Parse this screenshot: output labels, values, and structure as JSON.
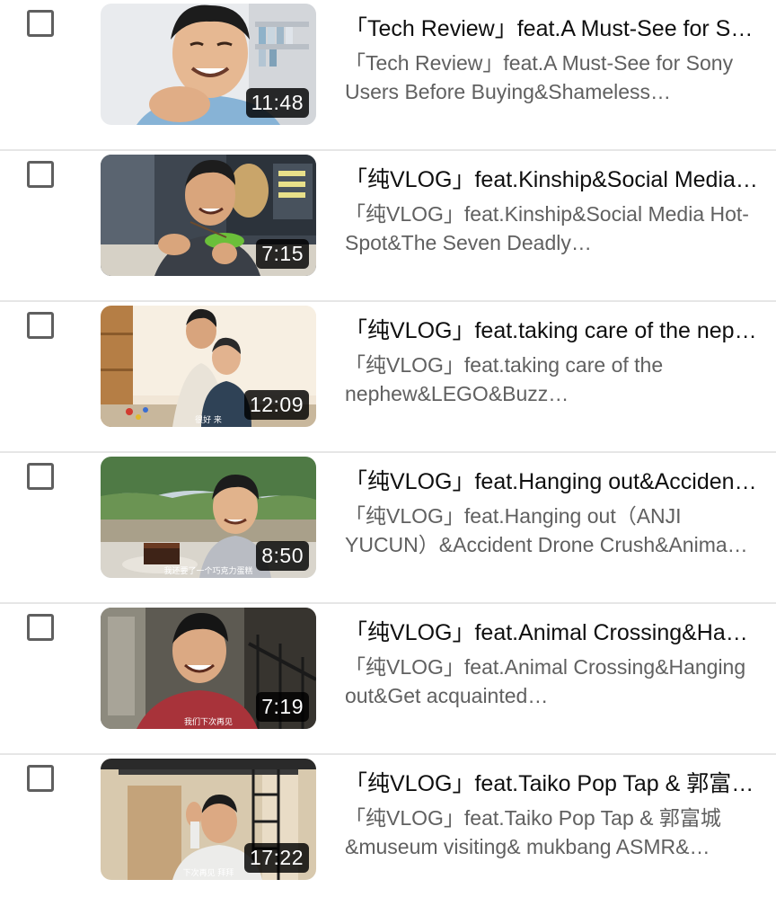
{
  "videos": [
    {
      "title": "「Tech Review」feat.A Must-See for Sony Users Before Buying&Shameless Self-Promotion",
      "description": "「Tech Review」feat.A Must-See for Sony Users Before Buying&Shameless…",
      "duration": "11:48",
      "thumbnail": "man-eating-portrait"
    },
    {
      "title": "「纯VLOG」feat.Kinship&Social Media Hot-Spot&The Seven Deadly Sins",
      "description": "「纯VLOG」feat.Kinship&Social Media Hot-Spot&The Seven Deadly…",
      "duration": "7:15",
      "thumbnail": "man-eating-salad"
    },
    {
      "title": "「纯VLOG」feat.taking care of the nephew&LEGO&Buzz Lightyear",
      "description": "「纯VLOG」feat.taking care of the nephew&LEGO&Buzz…",
      "duration": "12:09",
      "thumbnail": "man-with-child",
      "caption": "很好 来"
    },
    {
      "title": "「纯VLOG」feat.Hanging out&Accident Drone Crush&Animal Crossing",
      "description": "「纯VLOG」feat.Hanging out（ANJI YUCUN）&Accident Drone Crush&Anima…",
      "duration": "8:50",
      "thumbnail": "man-outdoors-cake",
      "caption": "我还要了一个巧克力蛋糕"
    },
    {
      "title": "「纯VLOG」feat.Animal Crossing&Hanging out&Get acquainted with friends",
      "description": "「纯VLOG」feat.Animal Crossing&Hanging out&Get acquainted…",
      "duration": "7:19",
      "thumbnail": "man-in-dorm",
      "caption": "我们下次再见"
    },
    {
      "title": "「纯VLOG」feat.Taiko Pop Tap & 郭富城&museum visiting& mukbang ASMR",
      "description": "「纯VLOG」feat.Taiko Pop Tap & 郭富城 &museum visiting& mukbang ASMR&…",
      "duration": "17:22",
      "thumbnail": "man-waving-dorm",
      "caption": "下次再见 拜拜"
    }
  ]
}
